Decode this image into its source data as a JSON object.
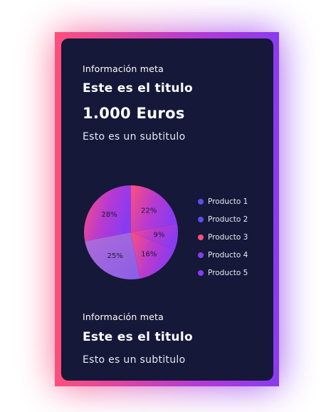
{
  "card_top": {
    "meta": "Información meta",
    "title": "Este es el titulo",
    "amount": "1.000 Euros",
    "subtitle": "Esto es un subtitulo"
  },
  "card_bottom": {
    "meta": "Información meta",
    "title": "Este es el titulo",
    "subtitle": "Esto es un subtitulo"
  },
  "colors": {
    "gradient_start": "#ff4f7b",
    "gradient_end": "#8a3bf0",
    "card_background": "#151838"
  },
  "chart_data": {
    "type": "pie",
    "title": "",
    "slices": [
      {
        "name": "Producto 1",
        "value": 22,
        "label": "22%",
        "legend_color": "#5b4ef0"
      },
      {
        "name": "Producto 2",
        "value": 9,
        "label": "9%",
        "legend_color": "#5a4ef2"
      },
      {
        "name": "Producto 3",
        "value": 16,
        "label": "16%",
        "legend_color": "#ff4f7b"
      },
      {
        "name": "Producto 4",
        "value": 25,
        "label": "25%",
        "legend_color": "#8a3bf0"
      },
      {
        "name": "Producto 5",
        "value": 28,
        "label": "28%",
        "legend_color": "#8a3bf0"
      }
    ],
    "legend_position": "right"
  }
}
